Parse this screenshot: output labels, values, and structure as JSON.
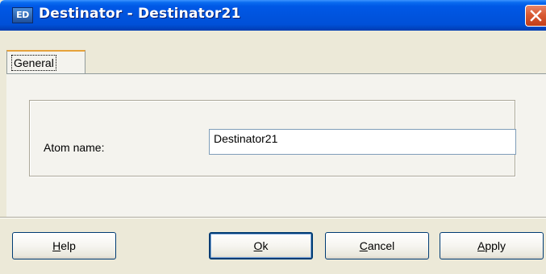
{
  "window": {
    "icon_text": "ED",
    "title": "Destinator - Destinator21"
  },
  "tabs": [
    {
      "label": "General",
      "active": true
    }
  ],
  "form": {
    "atom_name_label": "Atom name:",
    "atom_name_value": "Destinator21"
  },
  "buttons": {
    "help": {
      "mnemonic": "H",
      "rest": "elp"
    },
    "ok": {
      "mnemonic": "O",
      "rest": "k"
    },
    "cancel": {
      "mnemonic": "C",
      "rest": "ancel"
    },
    "apply": {
      "mnemonic": "A",
      "rest": "pply"
    }
  },
  "colors": {
    "titlebar": "#0053dd",
    "close_button": "#d95a33",
    "dialog_background": "#ece9d8",
    "tab_highlight": "#e6a23c"
  },
  "icons": {
    "app": "ed-app-icon",
    "close": "close-icon"
  }
}
